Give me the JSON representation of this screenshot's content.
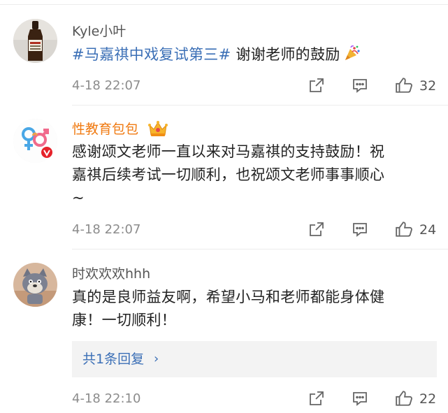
{
  "comments": [
    {
      "username": "Kyle小叶",
      "text_tag": "#马嘉祺中戏复试第三#",
      "text_main": "谢谢老师的鼓励",
      "time": "4-18 22:07",
      "likes": "32"
    },
    {
      "username": "性教育包包",
      "text_line1": "感谢颂文老师一直以来对马嘉祺的支持鼓励！祝",
      "text_line2": "嘉祺后续考试一切顺利，也祝颂文老师事事顺心",
      "text_line3": "~",
      "time": "4-18 22:07",
      "likes": "24"
    },
    {
      "username": "时欢欢欢hhh",
      "text_line1": "真的是良师益友啊，希望小马和老师都能身体健",
      "text_line2": "康！一切顺利！",
      "reply_label": "共1条回复",
      "reply_chevron": "›",
      "time": "4-18 22:10",
      "likes": "22"
    }
  ],
  "icons": {
    "share": "share-icon",
    "comment": "comment-icon",
    "like": "thumbs-up-icon",
    "crown": "crown-badge-icon",
    "party": "party-popper-icon",
    "verified": "verified-v-icon"
  },
  "colors": {
    "username": "#555555",
    "vip_username": "#f07a11",
    "topic": "#3b6fb6",
    "text": "#222222",
    "meta": "#8c8c8c",
    "reply_bg": "#f3f3f3"
  }
}
